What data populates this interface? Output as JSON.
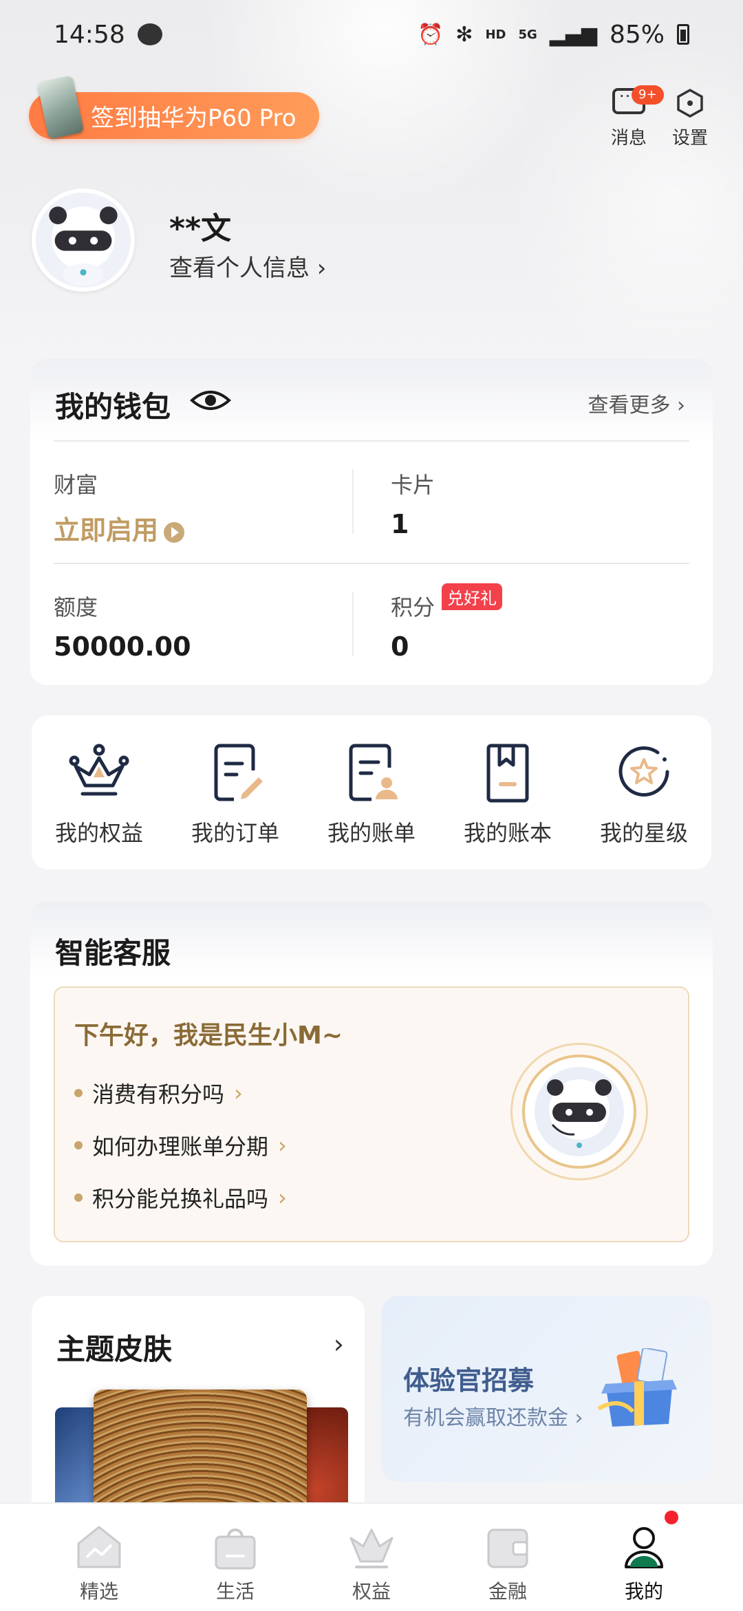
{
  "status_bar": {
    "time": "14:58",
    "hd": "HD",
    "network": "5G",
    "battery": "85%"
  },
  "promo": {
    "label": "签到抽华为P60 Pro"
  },
  "header_actions": {
    "messages_label": "消息",
    "messages_badge": "9+",
    "settings_label": "设置"
  },
  "profile": {
    "name": "**文",
    "link": "查看个人信息 ›"
  },
  "wallet": {
    "title": "我的钱包",
    "more": "查看更多 ›",
    "wealth_label": "财富",
    "wealth_value": "立即启用",
    "cards_label": "卡片",
    "cards_value": "1",
    "limit_label": "额度",
    "limit_value": "50000.00",
    "points_label": "积分",
    "points_tag": "兑好礼",
    "points_value": "0"
  },
  "quick_actions": [
    {
      "label": "我的权益",
      "icon": "crown-icon"
    },
    {
      "label": "我的订单",
      "icon": "order-icon"
    },
    {
      "label": "我的账单",
      "icon": "bill-icon"
    },
    {
      "label": "我的账本",
      "icon": "ledger-icon"
    },
    {
      "label": "我的星级",
      "icon": "star-level-icon"
    }
  ],
  "service": {
    "title": "智能客服",
    "greeting": "下午好，我是民生小M~",
    "faqs": [
      "消费有积分吗",
      "如何办理账单分期",
      "积分能兑换礼品吗"
    ]
  },
  "theme": {
    "title": "主题皮肤"
  },
  "recruit": {
    "title": "体验官招募",
    "subtitle": "有机会赢取还款金"
  },
  "nav": [
    {
      "label": "精选",
      "icon": "home-icon"
    },
    {
      "label": "生活",
      "icon": "bag-icon"
    },
    {
      "label": "权益",
      "icon": "crown-icon"
    },
    {
      "label": "金融",
      "icon": "wallet-icon"
    },
    {
      "label": "我的",
      "icon": "user-icon",
      "active": true
    }
  ],
  "colors": {
    "accent_orange": "#ff7b43",
    "gold": "#c09b63",
    "badge_red": "#f2414b",
    "active_nav": "#0f7a4d"
  }
}
